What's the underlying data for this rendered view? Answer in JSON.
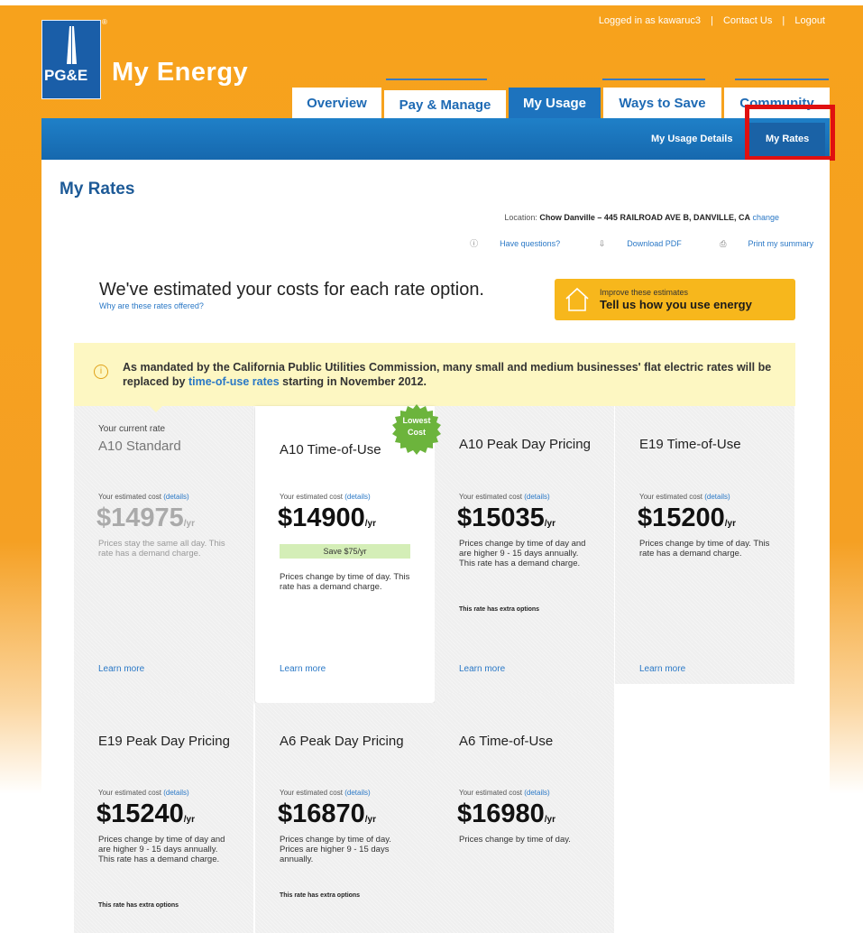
{
  "top_links": {
    "logged_in": "Logged in as kawaruc3",
    "sep1": "|",
    "contact": "Contact Us",
    "sep2": "|",
    "logout": "Logout"
  },
  "brand": {
    "logo_text": "PG&E",
    "app_name": "My Energy",
    "reg": "®"
  },
  "tabs": [
    {
      "label": "Overview"
    },
    {
      "label": "Pay & Manage"
    },
    {
      "label": "My Usage"
    },
    {
      "label": "Ways to Save"
    },
    {
      "label": "Community"
    }
  ],
  "subnav": [
    {
      "label": "My Usage Details"
    },
    {
      "label": "My Rates"
    }
  ],
  "page": {
    "title": "My Rates",
    "location_label": "Location:",
    "location_value": "Chow Danville – 445 RAILROAD AVE B, DANVILLE, CA",
    "location_change": "change",
    "questions": "Have questions?",
    "download": "Download PDF",
    "print": "Print my summary",
    "estimate_heading": "We've estimated your costs for each rate option.",
    "estimate_sub": "Why are these rates offered?",
    "improve_l1": "Improve these estimates",
    "improve_l2": "Tell us how you use energy"
  },
  "notice": {
    "pre": "As mandated by the California Public Utilities Commission, many small and medium businesses' flat electric rates will be replaced by ",
    "link": "time-of-use rates",
    "post": " starting in November 2012."
  },
  "badge": {
    "l1": "Lowest",
    "l2": "Cost"
  },
  "rates": [
    {
      "tag": "Your current rate",
      "name": "A10 Standard",
      "est": "Your estimated cost",
      "details": "(details)",
      "price": "$14975",
      "yr": "/yr",
      "desc": "Prices stay the same all day. This rate has a demand charge.",
      "learn": "Learn more"
    },
    {
      "name": "A10 Time-of-Use",
      "est": "Your estimated cost",
      "details": "(details)",
      "price": "$14900",
      "yr": "/yr",
      "save": "Save $75/yr",
      "desc": "Prices change by time of day. This rate has a demand charge.",
      "learn": "Learn more"
    },
    {
      "name": "A10 Peak Day Pricing",
      "est": "Your estimated cost",
      "details": "(details)",
      "price": "$15035",
      "yr": "/yr",
      "desc": "Prices change by time of day and are higher 9 - 15 days annually. This rate has a demand charge.",
      "extra": "This rate has extra options",
      "learn": "Learn more"
    },
    {
      "name": "E19 Time-of-Use",
      "est": "Your estimated cost",
      "details": "(details)",
      "price": "$15200",
      "yr": "/yr",
      "desc": "Prices change by time of day. This rate has a demand charge.",
      "learn": "Learn more"
    },
    {
      "name": "E19 Peak Day Pricing",
      "est": "Your estimated cost",
      "details": "(details)",
      "price": "$15240",
      "yr": "/yr",
      "desc": "Prices change by time of day and are higher 9 - 15 days annually. This rate has a demand charge.",
      "extra": "This rate has extra options"
    },
    {
      "name": "A6 Peak Day Pricing",
      "est": "Your estimated cost",
      "details": "(details)",
      "price": "$16870",
      "yr": "/yr",
      "desc": "Prices change by time of day. Prices are higher 9 - 15 days annually.",
      "extra": "This rate has extra options"
    },
    {
      "name": "A6 Time-of-Use",
      "est": "Your estimated cost",
      "details": "(details)",
      "price": "$16980",
      "yr": "/yr",
      "desc": "Prices change by time of day."
    }
  ],
  "colors": {
    "brand_orange": "#f7a21c",
    "nav_blue": "#1d73be",
    "link_blue": "#2a78c6",
    "title_blue": "#1d5a97",
    "highlight_red": "#e01010",
    "save_green": "#d4eeb7",
    "notice_yellow": "#fdf7c2"
  }
}
